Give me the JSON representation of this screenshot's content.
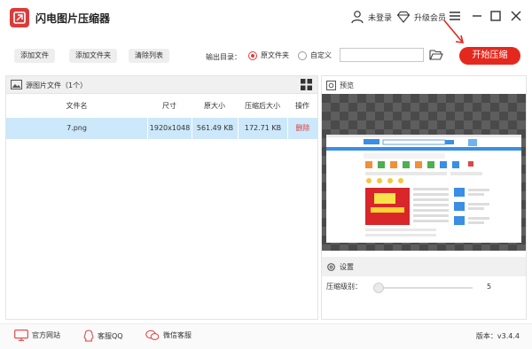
{
  "app": {
    "title": "闪电图片压缩器"
  },
  "header": {
    "login_label": "未登录",
    "vip_label": "升级会员"
  },
  "toolbar": {
    "add_file": "添加文件",
    "add_folder": "添加文件夹",
    "clear_list": "清除列表",
    "output_label": "输出目录：",
    "option_original": "原文件夹",
    "option_custom": "自定义",
    "path_value": "",
    "start_button": "开始压缩"
  },
  "file_list": {
    "title": "源图片文件（1个）",
    "columns": [
      "文件名",
      "尺寸",
      "原大小",
      "压缩后大小",
      "操作"
    ],
    "rows": [
      {
        "name": "7.png",
        "size": "1920x1048",
        "original": "561.49 KB",
        "compressed": "172.71 KB",
        "action": "删除"
      }
    ]
  },
  "preview": {
    "title": "预览"
  },
  "settings": {
    "title": "设置",
    "level_label": "压缩级别：",
    "level_value": "5"
  },
  "footer": {
    "website": "官方网站",
    "qq": "客服QQ",
    "wechat": "微信客服",
    "version": "版本：v3.4.4"
  },
  "colors": {
    "accent": "#e5281e",
    "row_selected": "#cce8fa"
  }
}
